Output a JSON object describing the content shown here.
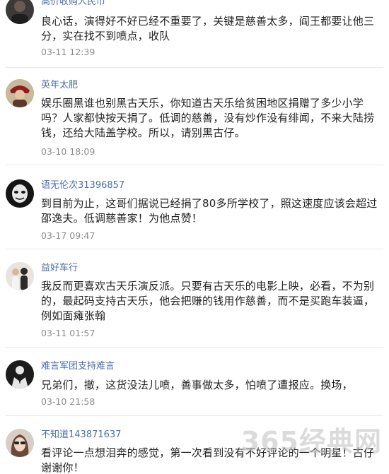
{
  "comments": [
    {
      "username": "高价收购人民币",
      "content": "良心话，演得好不好已经不重要了，关键是慈善太多，阎王都要让他三分，实在找不到喷点，收队",
      "time": "03-11 12:39",
      "avatar_icon": "dark-portrait-avatar"
    },
    {
      "username": "英年太肥",
      "content": "娱乐圈黑谁也别黑古天乐，你知道古天乐给贫困地区捐赠了多少小学吗？人家都快按天捐了。低调的慈善，没有炒作没有绯闻，不来大陆捞钱，还给大陆盖学校。所以，请别黑古仔。",
      "time": "03-10 18:09",
      "avatar_icon": "costume-portrait-avatar"
    },
    {
      "username": "语无伦次31396857",
      "content": "到目前为止，这哥们据说已经捐了80多所学校了，照这速度应该会超过邵逸夫。低调慈善家！为他点赞！",
      "time": "03-17 09:47",
      "avatar_icon": "dark-mask-avatar"
    },
    {
      "username": "益好车行",
      "content": "我反而更喜欢古天乐演反派。只要有古天乐的电影上映，必看，不为别的，最起码支持古天乐，他会把赚的钱用作慈善，而不是买跑车装逼，例如面瘫张翰",
      "time": "03-11 01:57",
      "avatar_icon": "couple-photo-avatar"
    },
    {
      "username": "难言军团支持难言",
      "content": "兄弟们，撤，这货没法儿喷，善事做太多，怕喷了遭报应。换场，",
      "time": "03-10 21:58",
      "avatar_icon": "suit-silhouette-avatar"
    },
    {
      "username": "不知道143871637",
      "content": "看评论一点想泪奔的感觉，第一次看到没有不好评论的一个明星！古仔谢谢你！",
      "time": "",
      "avatar_icon": "sunglasses-woman-avatar"
    }
  ],
  "watermark": "365经典网"
}
